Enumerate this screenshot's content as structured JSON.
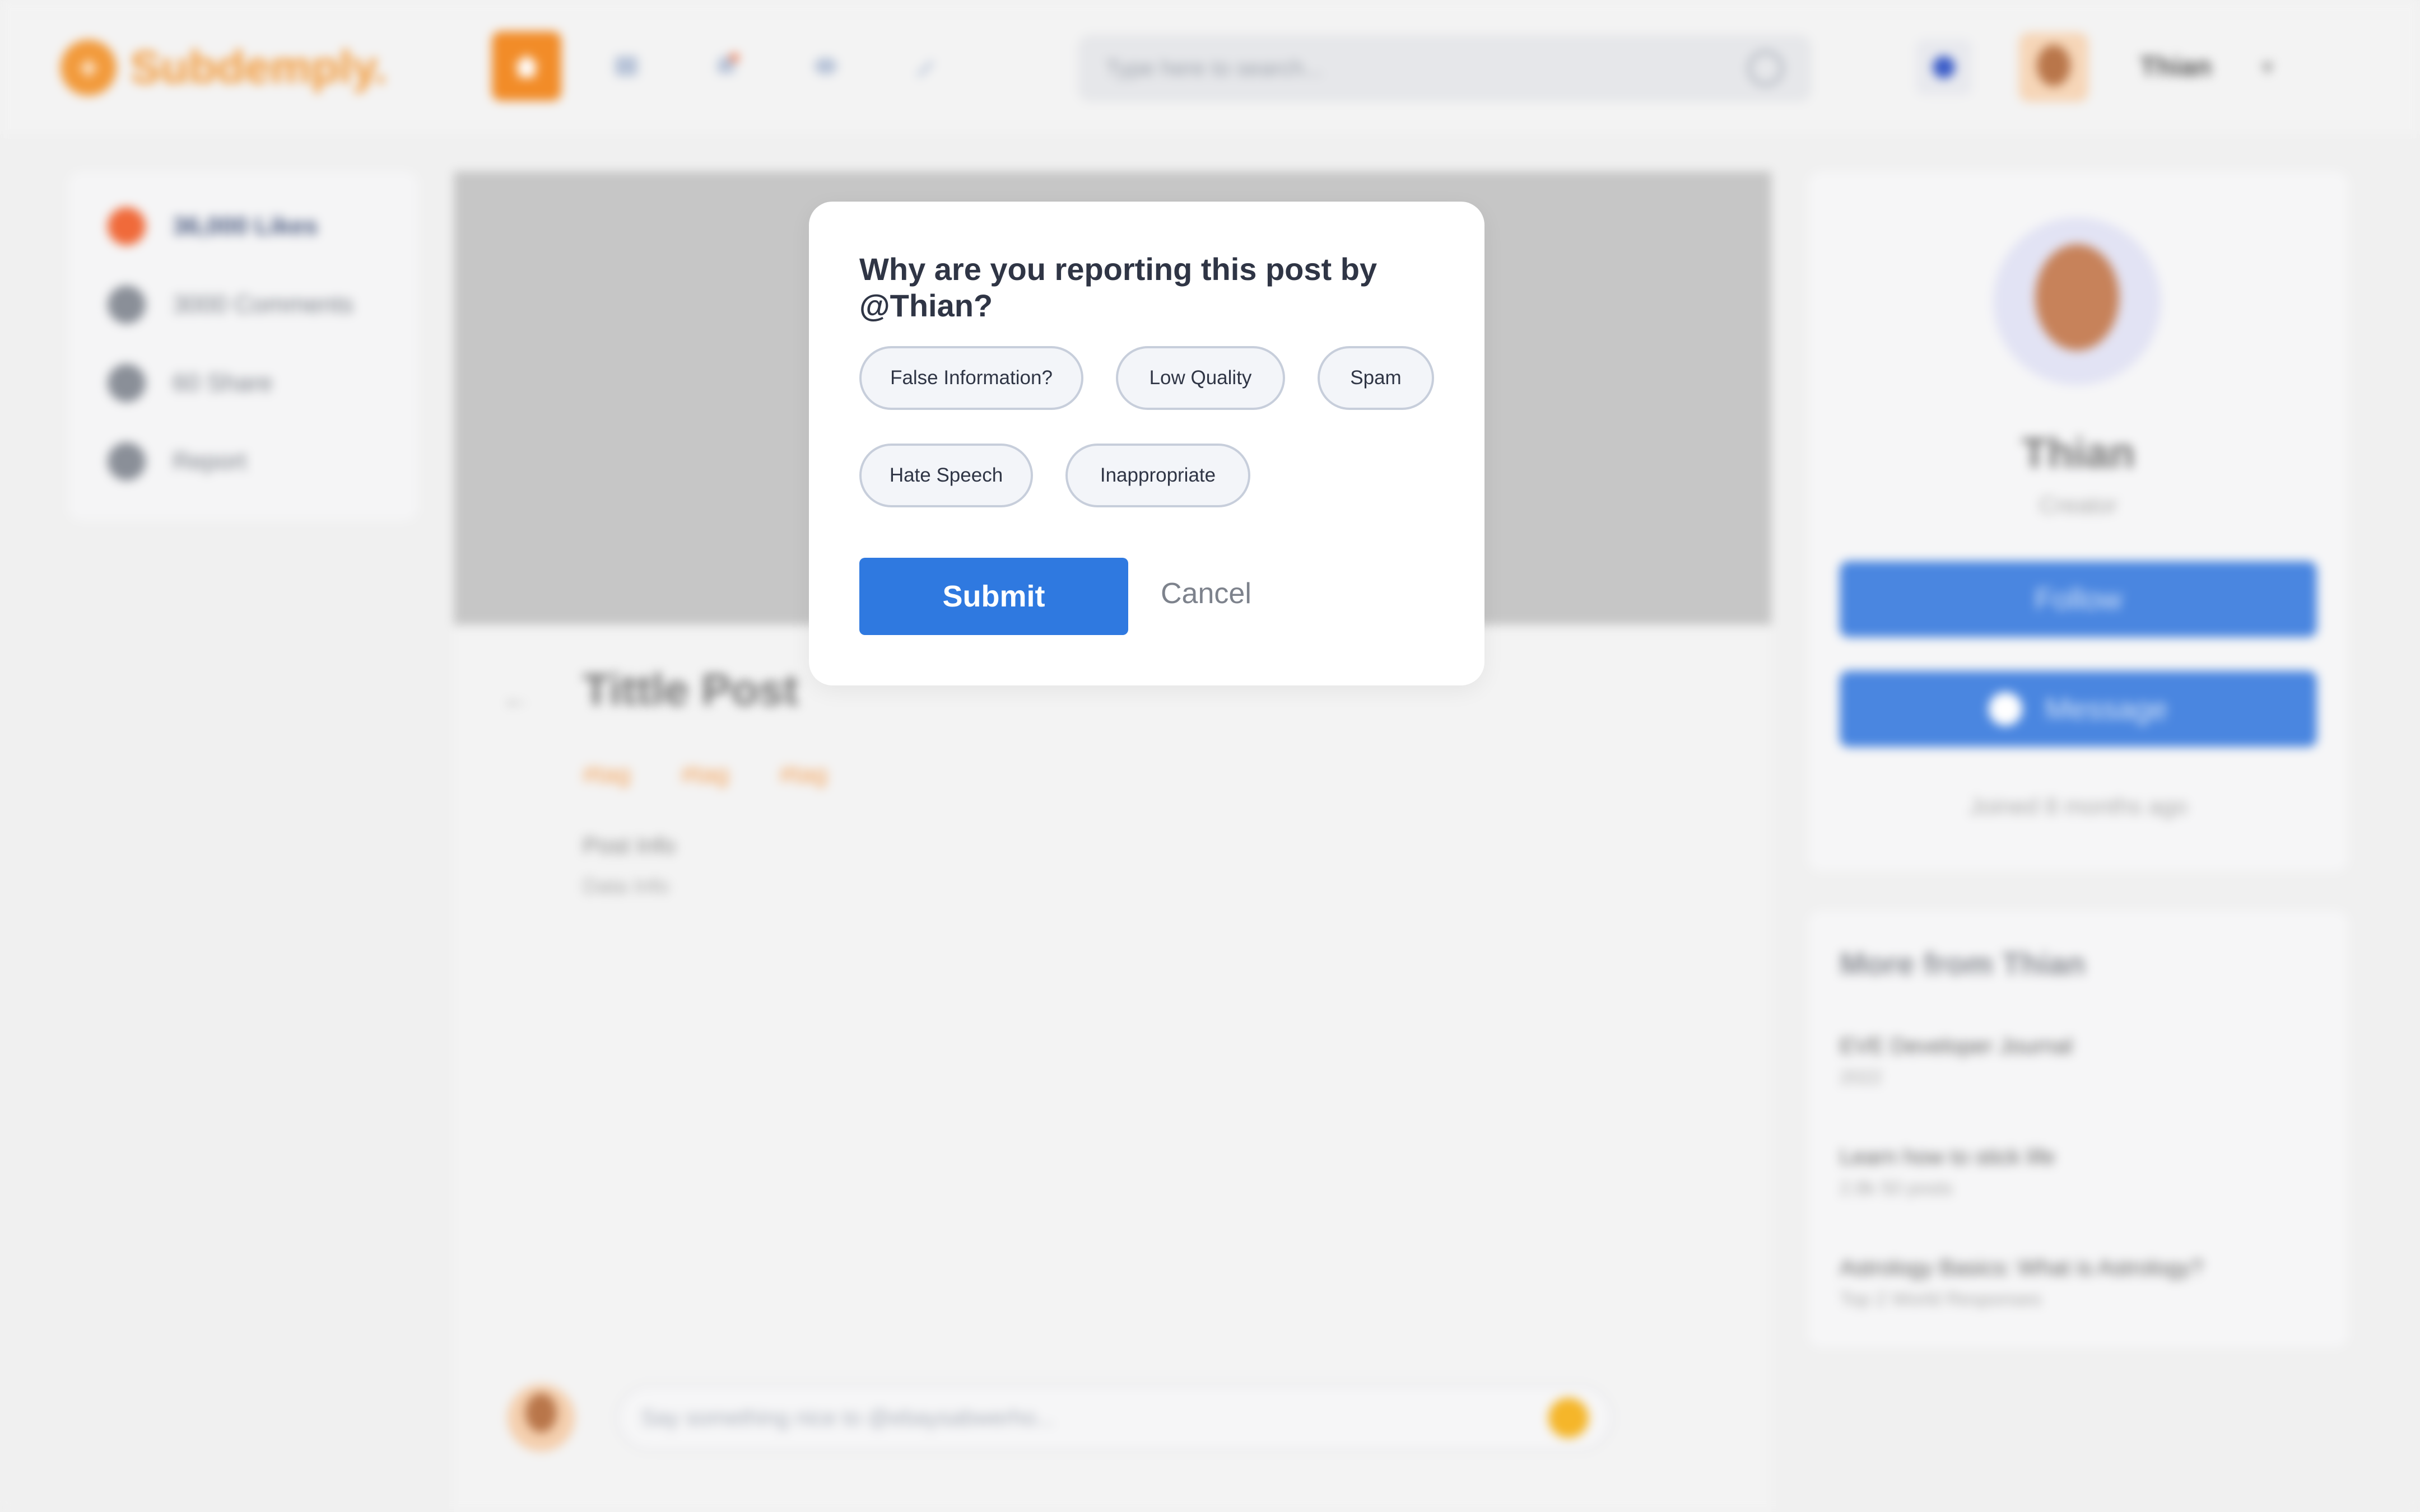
{
  "app": {
    "logo_text": "Subdemply.",
    "search_placeholder": "Type here to search...",
    "username": "Thian"
  },
  "sidebar": {
    "items": [
      {
        "label": "36,000 Likes"
      },
      {
        "label": "3000 Comments"
      },
      {
        "label": "60 Share"
      },
      {
        "label": "Report"
      }
    ]
  },
  "post": {
    "title": "Tittle Post",
    "tags": [
      "#tag",
      "#tag",
      "#tag"
    ],
    "info": "Post Info",
    "sub_info": "Data Info",
    "comment_placeholder": "Say something nice to @ebaysabwerho..."
  },
  "profile": {
    "name": "Thian",
    "role": "Creator",
    "follow_label": "Follow",
    "message_label": "Message",
    "joined": "Joined 8 months ago"
  },
  "more": {
    "title": "More from Thian",
    "items": [
      {
        "title": "EVE Developer Journal",
        "sub": "2022"
      },
      {
        "title": "Learn how to stick life",
        "sub": "2.8k 50 posts"
      },
      {
        "title": "Astrology Basics: What is Astrology?",
        "sub": "Top 2 World Responses"
      }
    ]
  },
  "modal": {
    "title": "Why are you reporting this post by @Thian?",
    "reasons": [
      "False Information?",
      "Low Quality",
      "Spam",
      "Hate Speech",
      "Inappropriate"
    ],
    "submit_label": "Submit",
    "cancel_label": "Cancel"
  },
  "colors": {
    "accent_orange": "#f28c28",
    "primary_blue": "#2f79e0",
    "overlay_bg": "#f0f0f0"
  }
}
